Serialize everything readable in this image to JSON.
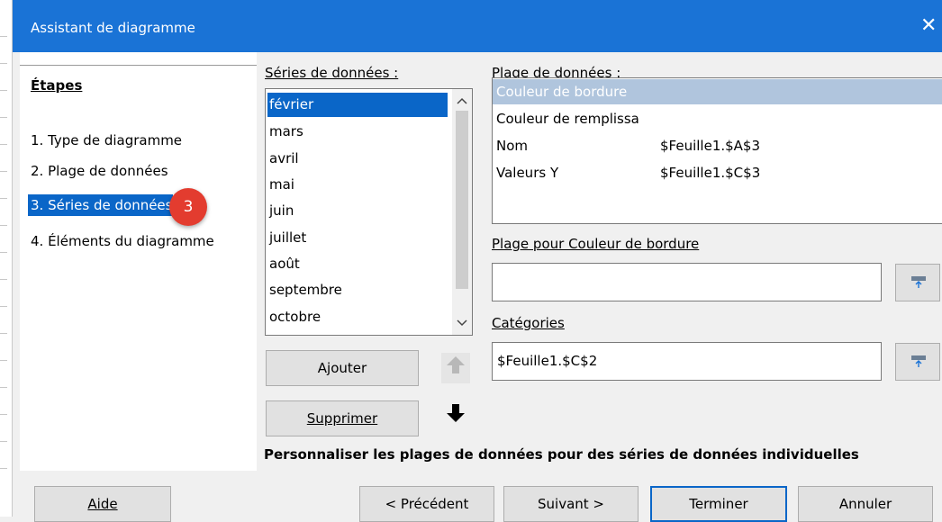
{
  "window": {
    "title": "Assistant de diagramme",
    "close_glyph": "✕"
  },
  "steps": {
    "heading": "Étapes",
    "items": [
      {
        "label": "1. Type de diagramme"
      },
      {
        "label": "2. Plage de données"
      },
      {
        "label": "3. Séries de données"
      },
      {
        "label": "4. Éléments du diagramme"
      }
    ],
    "selected_index": 2,
    "badge": "3"
  },
  "series_panel": {
    "label": "Séries de données :",
    "items": [
      "février",
      "mars",
      "avril",
      "mai",
      "juin",
      "juillet",
      "août",
      "septembre",
      "octobre"
    ],
    "selected": "février",
    "add_button": "Ajouter",
    "remove_button": "Supprimer"
  },
  "range_panel": {
    "label": "Plage de données :",
    "rows": [
      {
        "name": "Couleur de bordure",
        "value": ""
      },
      {
        "name": "Couleur de remplissa",
        "value": ""
      },
      {
        "name": "Nom",
        "value": "$Feuille1.$A$3"
      },
      {
        "name": "Valeurs Y",
        "value": "$Feuille1.$C$3"
      }
    ],
    "selected_row": 0,
    "range_for_label": "Plage pour Couleur de bordure",
    "range_for_value": "",
    "categories_label": "Catégories",
    "categories_value": "$Feuille1.$C$2"
  },
  "note": "Personnaliser les plages de données pour des séries de données individuelles",
  "footer": {
    "help": "Aide",
    "previous": "< Précédent",
    "next": "Suivant >",
    "finish": "Terminer",
    "cancel": "Annuler"
  },
  "icons": {
    "move_up": "arrow-up-icon",
    "move_down": "arrow-down-icon",
    "range_picker": "shrink-dialog-icon",
    "scroll_up": "chevron-up-icon",
    "scroll_down": "chevron-down-icon"
  },
  "colors": {
    "titlebar": "#1a73d6",
    "selection": "#0a66c8",
    "inactive_selection": "#b0c5dd",
    "badge": "#e33c2f"
  }
}
